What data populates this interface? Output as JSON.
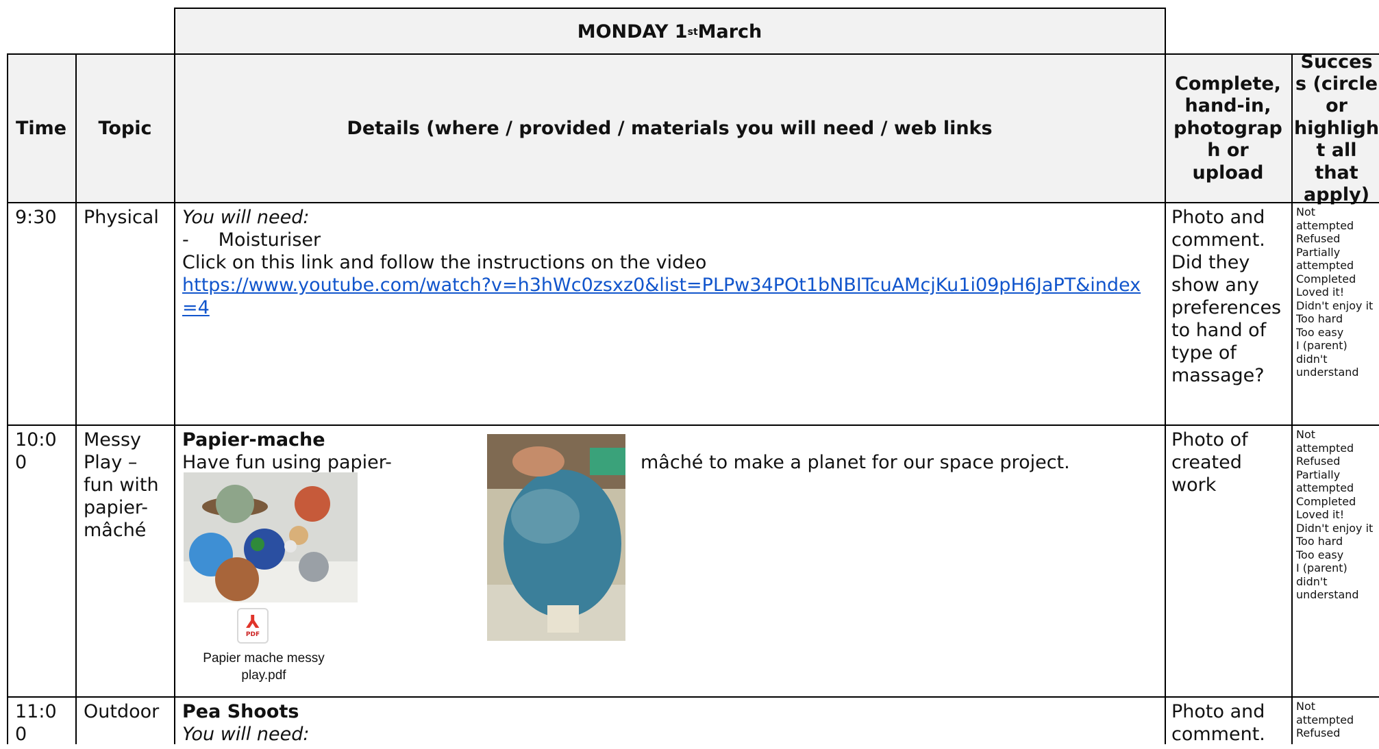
{
  "title": {
    "day": "MONDAY 1",
    "sup": "st",
    "month": " March"
  },
  "headers": {
    "time": "Time",
    "topic": "Topic",
    "details": "Details (where / provided / materials you will need / web links",
    "complete": "Complete, hand-in, photograp h or upload",
    "success": "Succes s (circle or highligh t all that apply)"
  },
  "success_options": [
    "Not attempted",
    "Refused",
    "Partially attempted",
    "Completed",
    "Loved it!",
    "Didn't enjoy it",
    "Too hard",
    "Too easy",
    "I (parent) didn't understand"
  ],
  "rows": [
    {
      "time": "9:30",
      "topic": "Physical",
      "need": "You will need:",
      "item": "-     Moisturiser",
      "instruction": "Click on this link and follow the instructions on the video",
      "link": "https://www.youtube.com/watch?v=h3hWc0zsxz0&list=PLPw34POt1bNBITcuAMcjKu1i09pH6JaPT&index=4",
      "complete": "Photo and comment. Did they show any preferences to hand of type of massage?"
    },
    {
      "time": "10:00",
      "topic": "Messy Play – fun with papier-mâché",
      "heading": "Papier-mache",
      "text_a": "Have fun using papier-",
      "text_b": "mâché to make a planet for our space project.",
      "attachment": "Papier mache messy play.pdf",
      "complete": "Photo of created work"
    },
    {
      "time": "11:00",
      "topic": "Outdoor",
      "heading": "Pea Shoots",
      "need": "You will need:",
      "complete": "Photo and comment."
    }
  ],
  "colors": {
    "grid": "#000000",
    "header_bg": "#f2f2f2",
    "link": "#1155cc",
    "pdf_red": "#e0342a"
  }
}
